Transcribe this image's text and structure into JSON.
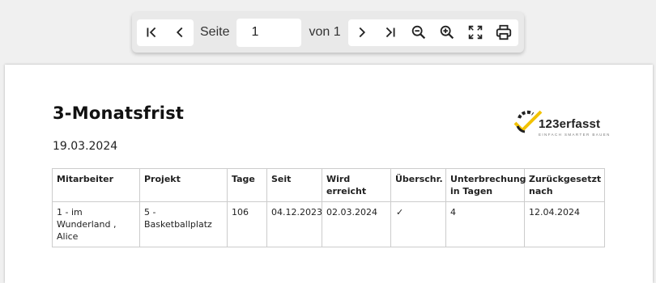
{
  "toolbar": {
    "page_label": "Seite",
    "page_value": "1",
    "of_label": "von 1",
    "buttons": [
      "first-page-icon",
      "previous-page-icon",
      "next-page-icon",
      "last-page-icon",
      "zoom-out-icon",
      "zoom-in-icon",
      "fullscreen-icon",
      "print-icon"
    ]
  },
  "report": {
    "title": "3-Monatsfrist",
    "date": "19.03.2024",
    "logo_text": "123erfasst",
    "logo_tagline": "EINFACH SMARTER BAUEN",
    "logo_colors": {
      "accent": "#f2c200",
      "dark": "#222222"
    },
    "columns": [
      "Mitarbeiter",
      "Projekt",
      "Tage",
      "Seit",
      "Wird erreicht",
      "Überschr.",
      "Unterbrechung in Tagen",
      "Zurückgesetzt nach"
    ],
    "rows": [
      {
        "mitarbeiter": "1 - im Wunderland , Alice",
        "projekt": "5 - Basketballplatz",
        "tage": "106",
        "seit": "04.12.2023",
        "wird_erreicht": "02.03.2024",
        "ueberschr": "✓",
        "unterbrechung": "4",
        "zurueckgesetzt": "12.04.2024"
      }
    ]
  }
}
